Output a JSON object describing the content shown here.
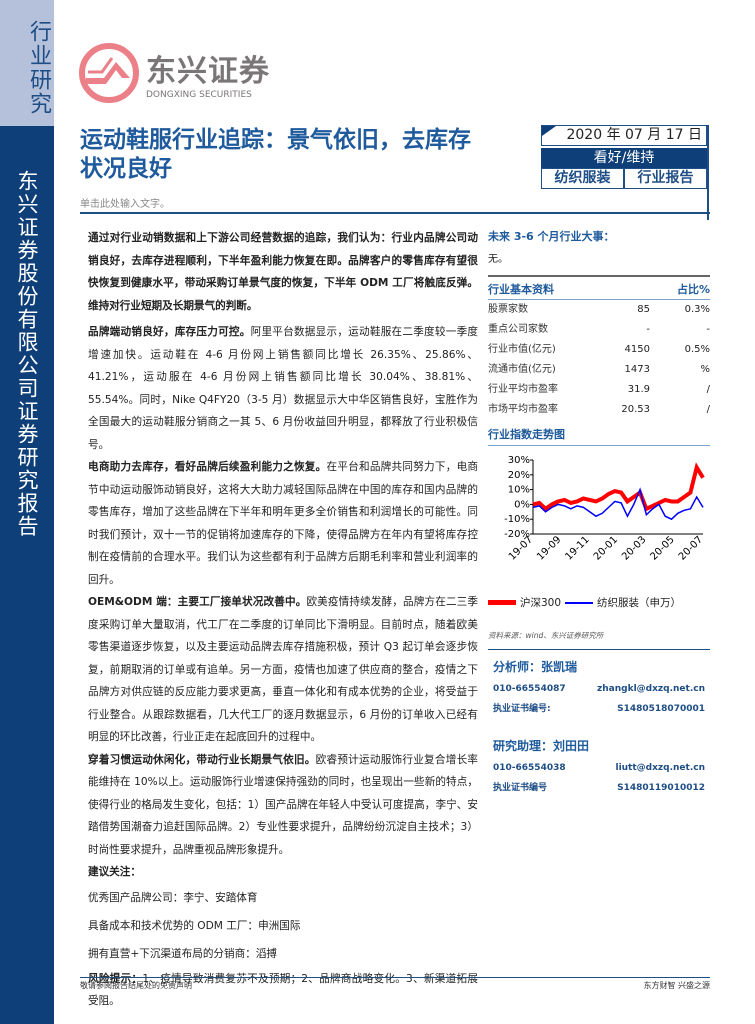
{
  "sidebar": {
    "category": "行业研究",
    "company_report": "东兴证券股份有限公司证券研究报告"
  },
  "logo": {
    "cn": "东兴证券",
    "en": "DONGXING SECURITIES"
  },
  "title": "运动鞋服行业追踪：景气依旧，去库存状况良好",
  "subtitle": "单击此处输入文字。",
  "header_box": {
    "date": "2020 年 07 月 17 日",
    "rating": "看好/维持",
    "sector": "纺织服装",
    "report_type": "行业报告"
  },
  "body": {
    "summary": "通过对行业动销数据和上下游公司经营数据的追踪，我们认为：行业内品牌公司动销良好，去库存进程顺利，下半年盈利能力恢复在即。品牌客户的零售库存有望很快恢复到健康水平，带动采购订单景气度的恢复，下半年 ODM 工厂将触底反弹。维持对行业短期及长期景气的判断。",
    "p1_head": "品牌端动销良好，库存压力可控。",
    "p1": "阿里平台数据显示，运动鞋服在二季度较一季度增速加快。运动鞋在 4-6 月份网上销售额同比增长 26.35%、25.86%、41.21%，运动服在 4-6 月份网上销售额同比增长 30.04%、38.81%、55.54%。同时，Nike Q4FY20（3-5 月）数据显示大中华区销售良好，宝胜作为全国最大的运动鞋服分销商之一其 5、6 月份收益回升明显，都释放了行业积极信号。",
    "p2_head": "电商助力去库存，看好品牌后续盈利能力之恢复。",
    "p2": "在平台和品牌共同努力下，电商节中动运动服饰动销良好，这将大大助力减轻国际品牌在中国的库存和国内品牌的零售库存，增加了这些品牌在下半年和明年更多全价销售和利润增长的可能性。同时我们预计，双十一节的促销将加速库存的下降，使得品牌方在年内有望将库存控制在疫情前的合理水平。我们认为这些都有利于品牌方后期毛利率和营业利润率的回升。",
    "p3_head": "OEM&ODM 端：主要工厂接单状况改善中。",
    "p3": "欧美疫情持续发酵，品牌方在二三季度采购订单大量取消，代工厂在二季度的订单同比下滑明显。目前时点，随着欧美零售渠道逐步恢复，以及主要运动品牌去库存措施积极，预计 Q3 起订单会逐步恢复，前期取消的订单或有追单。另一方面，疫情也加速了供应商的整合，疫情之下品牌方对供应链的反应能力要求更高，垂直一体化和有成本优势的企业，将受益于行业整合。从跟踪数据看，几大代工厂的逐月数据显示，6 月份的订单收入已经有明显的环比改善，行业正走在起底回升的过程中。",
    "p4_head": "穿着习惯运动休闲化，带动行业长期景气依旧。",
    "p4": "欧睿预计运动服饰行业复合增长率能维持在 10%以上。运动服饰行业增速保持强劲的同时，也呈现出一些新的特点，使得行业的格局发生变化，包括：1）国产品牌在年轻人中受认可度提高，李宁、安踏借势国潮奋力追赶国际品牌。2）专业性要求提升，品牌纷纷沉淀自主技术；3）时尚性要求提升，品牌重视品牌形象提升。",
    "rec_head": "建议关注：",
    "rec": [
      "优秀国产品牌公司：李宁、安踏体育",
      "具备成本和技术优势的 ODM 工厂：申洲国际",
      "拥有直营+下沉渠道布局的分销商：滔搏"
    ],
    "risk_head": "风险提示：",
    "risk": "1、疫情导致消费复苏不及预期；2、品牌商战略变化。3、新渠道拓展受阻。"
  },
  "right": {
    "events_title": "未来 3-6 个月行业大事：",
    "events": "无。",
    "table_title": "行业基本资料",
    "table_col": "占比%",
    "rows": [
      [
        "股票家数",
        "85",
        "0.3%"
      ],
      [
        "重点公司家数",
        "-",
        "-"
      ],
      [
        "行业市值(亿元)",
        "4150",
        "0.5%"
      ],
      [
        "流通市值(亿元)",
        "1473",
        "%"
      ],
      [
        "行业平均市盈率",
        "31.9",
        "/"
      ],
      [
        "市场平均市盈率",
        "20.53",
        "/"
      ]
    ],
    "chart_title": "行业指数走势图",
    "source": "资料来源：wind、东兴证券研究所",
    "analyst_title": "分析师：张凯瑞",
    "analyst_phone": "010-66554087",
    "analyst_email": "zhangkl@dxzq.net.cn",
    "cert_label": "执业证书编号:",
    "analyst_cert": "S1480518070001",
    "assistant_title": "研究助理：刘田田",
    "assistant_phone": "010-66554038",
    "assistant_email": "liutt@dxzq.net.cn",
    "cert_label2": "执业证书编号",
    "assistant_cert": "S1480119010012"
  },
  "chart_data": {
    "type": "line",
    "title": "行业指数走势图",
    "x_ticks": [
      "19-07",
      "19-09",
      "19-11",
      "20-01",
      "20-03",
      "20-05",
      "20-07"
    ],
    "y_ticks": [
      "30%",
      "20%",
      "10%",
      "0%",
      "-10%",
      "-20%"
    ],
    "ylim": [
      -20,
      30
    ],
    "series": [
      {
        "name": "沪深300",
        "color": "#ff0000",
        "values": [
          0,
          1,
          -3,
          0,
          2,
          3,
          1,
          2,
          4,
          3,
          2,
          4,
          7,
          9,
          8,
          2,
          5,
          8,
          -3,
          -1,
          1,
          3,
          2,
          2,
          5,
          8,
          25,
          18
        ]
      },
      {
        "name": "纺织服装（申万）",
        "color": "#0000ff",
        "values": [
          -2,
          -1,
          -5,
          -2,
          0,
          -1,
          -3,
          -1,
          -2,
          -5,
          -8,
          -6,
          -2,
          2,
          1,
          -8,
          0,
          10,
          -7,
          -3,
          0,
          -8,
          -10,
          -6,
          -4,
          -3,
          5,
          -2
        ]
      }
    ]
  },
  "footer": {
    "left": "敬请参阅报告结尾处的免责声明",
    "right": "东方财智 兴盛之源"
  }
}
